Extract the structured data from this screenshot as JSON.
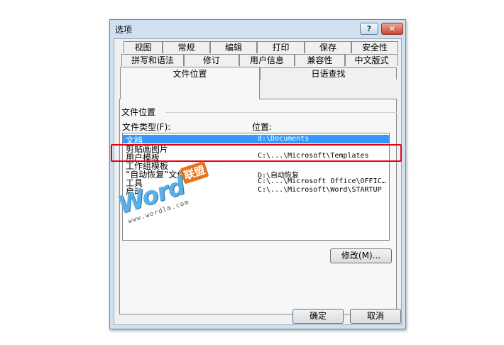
{
  "window": {
    "title": "选项",
    "help_label": "?",
    "close_label": "✕"
  },
  "tabs": {
    "row1": [
      "视图",
      "常规",
      "编辑",
      "打印",
      "保存",
      "安全性"
    ],
    "row2": [
      "拼写和语法",
      "修订",
      "用户信息",
      "兼容性",
      "中文版式"
    ],
    "row3": [
      "文件位置",
      "日语查找"
    ],
    "active": "文件位置"
  },
  "group": {
    "title": "文件位置"
  },
  "list": {
    "header_type": "文件类型(F):",
    "header_location": "位置:",
    "rows": [
      {
        "type": "文档",
        "location": "d:\\Documents",
        "selected": true
      },
      {
        "type": "剪贴画图片",
        "location": ""
      },
      {
        "type": "用户模板",
        "location": "C:\\...\\Microsoft\\Templates"
      },
      {
        "type": "工作组模板",
        "location": ""
      },
      {
        "type": "“自动恢复”文件",
        "location": "D:\\自动恢复"
      },
      {
        "type": "工具",
        "location": "C:\\...\\Microsoft Office\\OFFIC…"
      },
      {
        "type": "启动",
        "location": "C:\\...\\Microsoft\\Word\\STARTUP"
      }
    ]
  },
  "buttons": {
    "modify": "修改(M)...",
    "ok": "确定",
    "cancel": "取消"
  },
  "watermark": {
    "main": "Word",
    "cn": "联盟",
    "url": "www.wordlm.com"
  },
  "colors": {
    "selection": "#3399ff",
    "highlight_box": "#e60012",
    "watermark_blue": "#5ab0e4",
    "watermark_orange": "#e8731a"
  }
}
